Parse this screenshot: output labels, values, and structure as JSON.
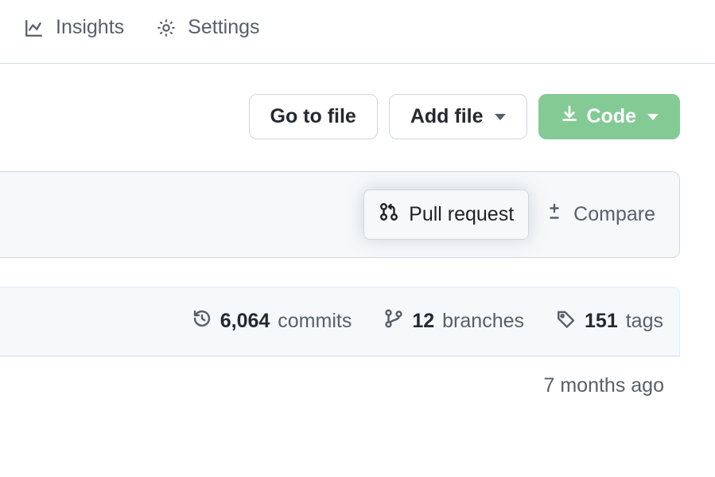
{
  "nav": {
    "insights": "Insights",
    "settings": "Settings"
  },
  "toolbar": {
    "go_to_file": "Go to file",
    "add_file": "Add file",
    "code": "Code"
  },
  "compare": {
    "pull_request": "Pull request",
    "compare": "Compare"
  },
  "stats": {
    "commits_count": "6,064",
    "commits_label": "commits",
    "branches_count": "12",
    "branches_label": "branches",
    "tags_count": "151",
    "tags_label": "tags"
  },
  "row": {
    "time": "7 months ago"
  }
}
